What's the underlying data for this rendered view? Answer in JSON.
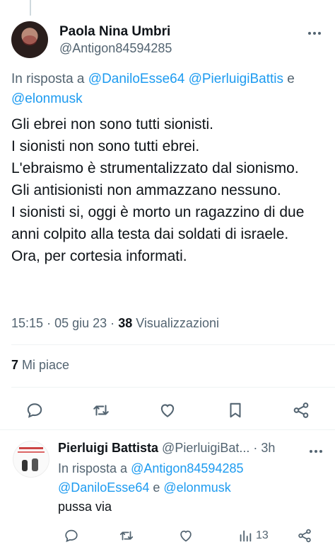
{
  "tweet": {
    "author_name": "Paola Nina Umbri",
    "author_handle": "@Antigon84594285",
    "reply_prefix": "In risposta a",
    "reply_mentions": [
      "@DaniloEsse64",
      "@PierluigiBattis"
    ],
    "reply_conj": "e",
    "reply_last": "@elonmusk",
    "text_lines": [
      "Gli ebrei non sono tutti sionisti.",
      "I sionisti non sono tutti ebrei.",
      "L'ebraismo è strumentalizzato dal sionismo.",
      "Gli antisionisti non ammazzano nessuno.",
      "I sionisti si, oggi è morto un ragazzino di due anni colpito alla testa dai soldati di israele.",
      "Ora, per cortesia informati."
    ],
    "time": "15:15",
    "dot": "·",
    "date": "05 giu 23",
    "views_count": "38",
    "views_label": "Visualizzazioni",
    "likes_count": "7",
    "likes_label": "Mi piace"
  },
  "icons": [
    "reply-icon",
    "retweet-icon",
    "like-icon",
    "bookmark-icon",
    "share-icon",
    "views-icon",
    "more-icon"
  ],
  "reply": {
    "author_name": "Pierluigi Battista",
    "author_handle": "@PierluigiBat...",
    "time": "· 3h",
    "reply_prefix": "In risposta a",
    "reply_mention1": "@Antigon84594285",
    "reply_mention2": "@DaniloEsse64",
    "reply_conj": "e",
    "reply_last": "@elonmusk",
    "text": "pussa via",
    "views_count": "13"
  },
  "colors": {
    "link": "#1d9bf0",
    "secondary": "#536471",
    "primary": "#0f1419",
    "divider": "#eff3f4"
  }
}
